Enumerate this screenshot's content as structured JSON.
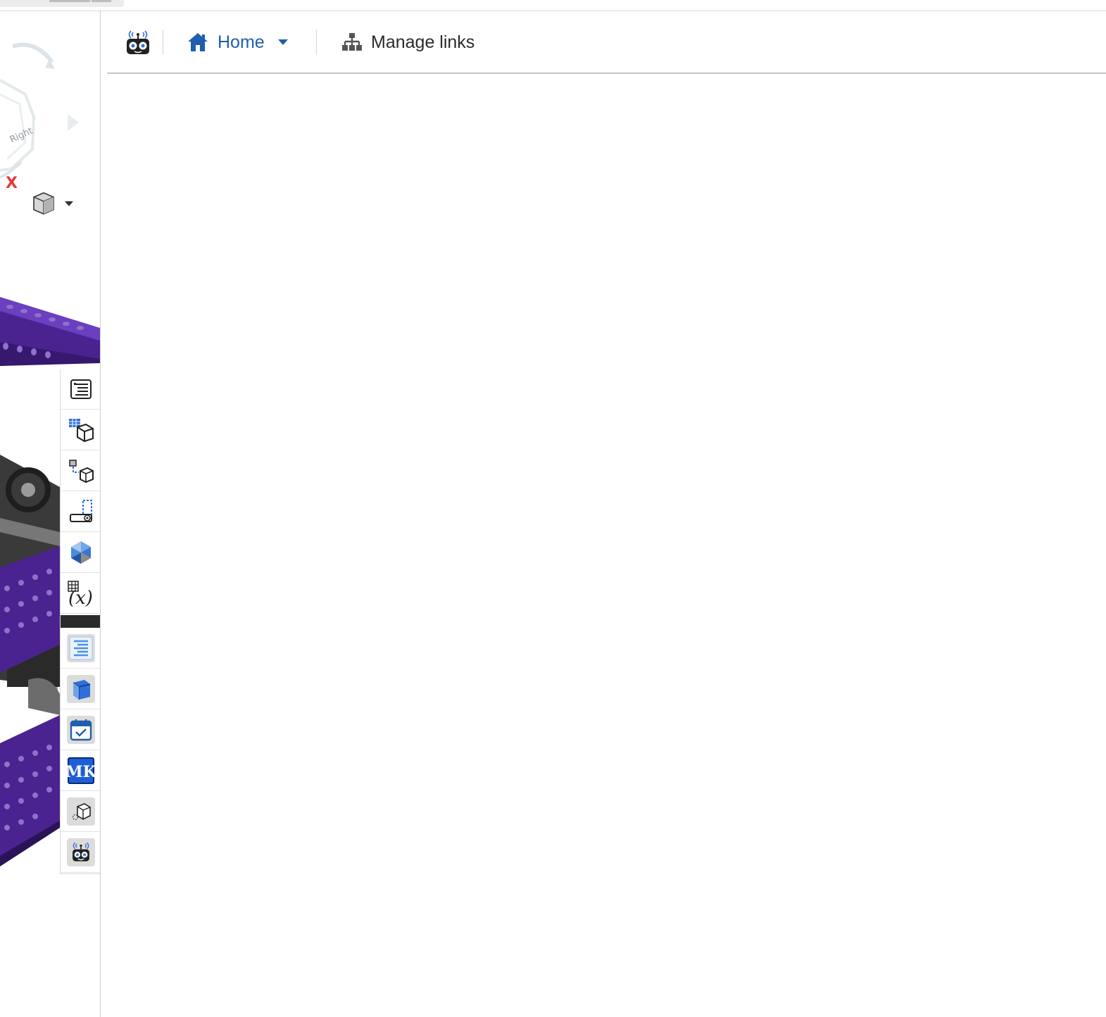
{
  "nav": {
    "logo_icon": "robot-logo-icon",
    "home_label": "Home",
    "home_icon": "home-icon",
    "manage_links_label": "Manage links",
    "manage_links_icon": "sitemap-icon"
  },
  "viewport": {
    "view_cube_face": "Right",
    "axis_label": "X",
    "model_color": "#5b2d9e"
  },
  "panel_toolbar": {
    "tools": [
      {
        "icon": "feature-list-icon"
      },
      {
        "icon": "parts-table-icon"
      },
      {
        "icon": "instances-icon"
      },
      {
        "icon": "mate-connector-icon"
      },
      {
        "icon": "appearance-icon"
      },
      {
        "icon": "variables-icon"
      },
      {
        "icon": "bom-app-icon"
      },
      {
        "icon": "part-studio-app-icon"
      },
      {
        "icon": "calendar-app-icon"
      },
      {
        "icon": "mk-app-icon",
        "text": "MK"
      },
      {
        "icon": "model-app-icon"
      },
      {
        "icon": "robot-app-icon"
      }
    ]
  }
}
